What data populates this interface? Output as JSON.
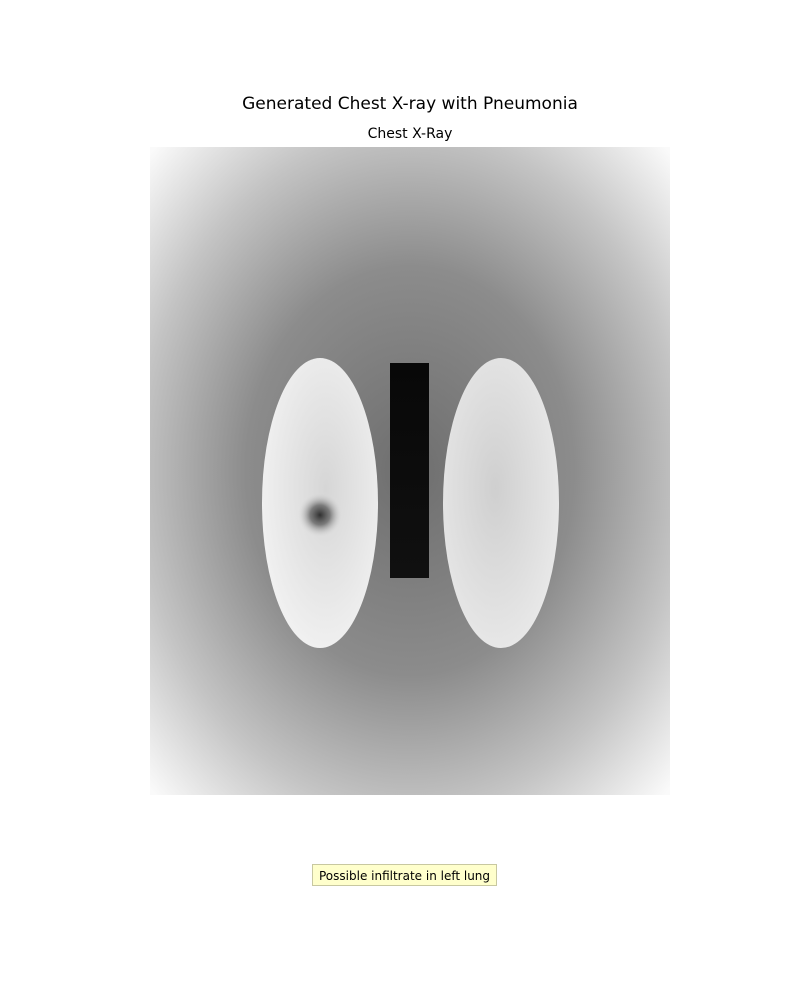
{
  "figure": {
    "title": "Generated Chest X-ray with Pneumonia",
    "subtitle": "Chest X-Ray"
  },
  "image": {
    "description_label": "chest-xray-image",
    "background_center_color": "#6e6e6e",
    "background_edge_color": "#fafafa",
    "lung_color": "#e4e4e4",
    "spine_color": "#0a0a0a",
    "opacity_color": "#303030"
  },
  "annotation": {
    "text": "Possible infiltrate in left lung",
    "background_color": "#ffffcc",
    "border_color": "#c8c8a0"
  }
}
